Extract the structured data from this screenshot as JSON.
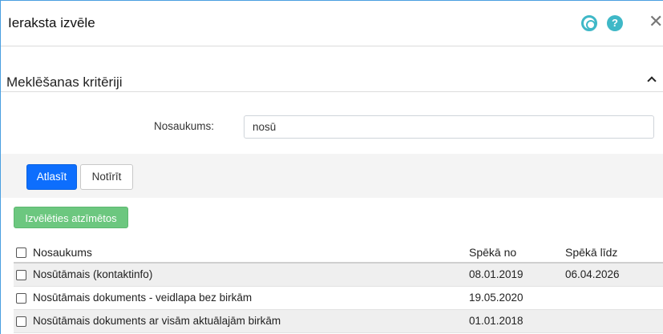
{
  "dialog": {
    "title": "Ieraksta izvēle",
    "icons": [
      "lifebuoy-icon",
      "help-icon",
      "close-icon"
    ],
    "help_glyph": "?",
    "close_glyph": "✕"
  },
  "criteria": {
    "title": "Meklēšanas kritēriji",
    "field_label": "Nosaukums:",
    "field_value": "nosū"
  },
  "actions": {
    "search_label": "Atlasīt",
    "clear_label": "Notīrīt",
    "select_marked_label": "Izvēlēties atzīmētos"
  },
  "colors": {
    "primary": "#0d6efd",
    "success": "#6cc77f",
    "accent": "#3fb8c7"
  },
  "table": {
    "columns": [
      "Nosaukums",
      "Spēkā no",
      "Spēkā līdz"
    ],
    "rows": [
      {
        "name": "Nosūtāmais (kontaktinfo)",
        "from": "08.01.2019",
        "to": "06.04.2026"
      },
      {
        "name": "Nosūtāmais dokuments - veidlapa bez birkām",
        "from": "19.05.2020",
        "to": ""
      },
      {
        "name": "Nosūtāmais dokuments ar visām aktuālajām birkām",
        "from": "01.01.2018",
        "to": ""
      }
    ]
  }
}
